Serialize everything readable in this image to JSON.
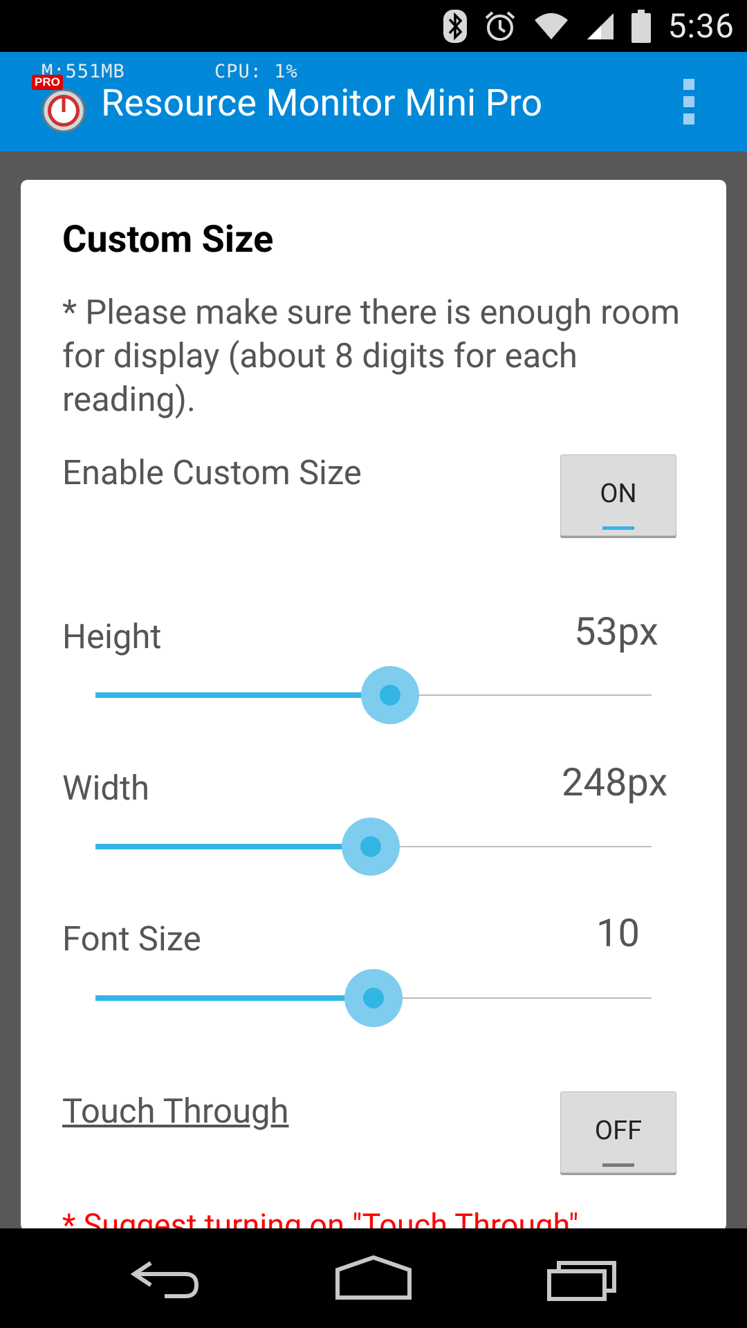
{
  "status_bar": {
    "time": "5:36",
    "icons": [
      "bluetooth-icon",
      "alarm-icon",
      "wifi-icon",
      "signal-icon",
      "battery-icon"
    ]
  },
  "overlay": {
    "memory": "M:551MB",
    "cpu": "CPU: 1%"
  },
  "action_bar": {
    "title": "Resource Monitor Mini Pro",
    "badge": "PRO",
    "menu_icon": "overflow-menu-icon",
    "color": "#0288d8"
  },
  "dialog": {
    "title": "Custom Size",
    "description": "* Please make sure there is enough room for display (about 8 digits for each reading).",
    "enable_custom_size": {
      "label": "Enable Custom Size",
      "state": "ON"
    },
    "height": {
      "label": "Height",
      "value": "53px",
      "position": 0.53
    },
    "width": {
      "label": "Width",
      "value": "248px",
      "position": 0.495
    },
    "font_size": {
      "label": "Font Size",
      "value": "10",
      "position": 0.5
    },
    "touch_through": {
      "label": "Touch Through",
      "state": "OFF"
    },
    "suggestion": "* Suggest turning on \"Touch Through\""
  },
  "colors": {
    "accent": "#33b5e5",
    "warning": "#ff0000"
  },
  "nav_bar": {
    "buttons": [
      "back-icon",
      "home-icon",
      "recent-apps-icon"
    ]
  }
}
